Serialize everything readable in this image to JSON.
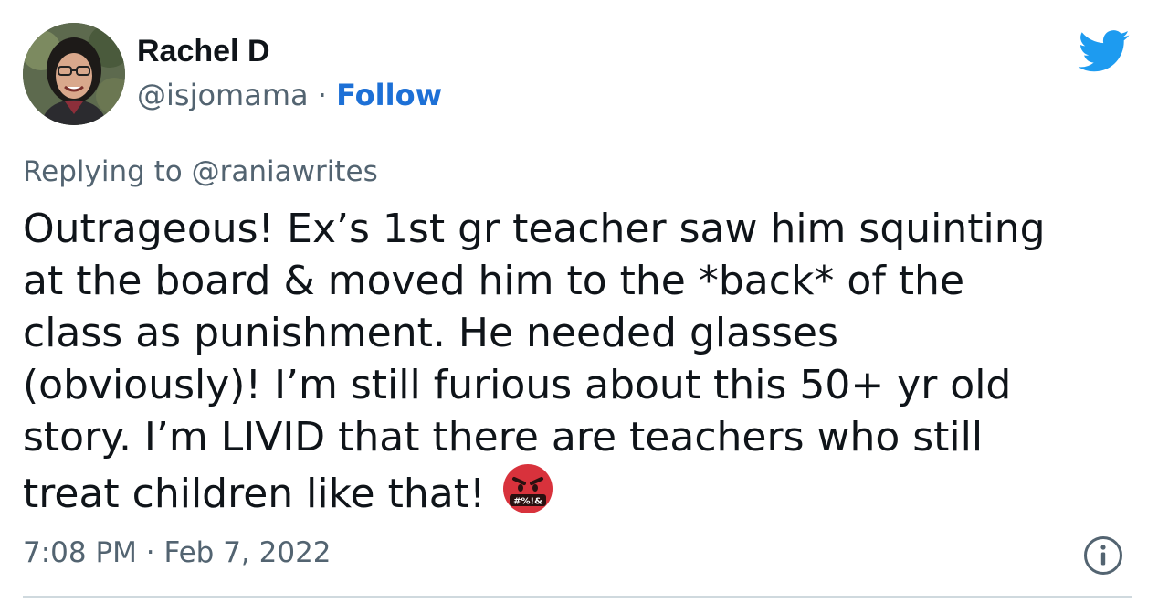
{
  "author": {
    "name": "Rachel D",
    "handle": "@isjomama",
    "separator": "·",
    "follow_label": "Follow"
  },
  "reply": {
    "prefix": "Replying to",
    "mention": "@raniawrites"
  },
  "tweet_text_lines": [
    "Outrageous! Ex’s 1st gr teacher saw him squinting",
    "at the board & moved him to the *back* of the",
    "class as punishment. He needed glasses",
    "(obviously)! I’m still furious about this 50+ yr old",
    "story. I’m LIVID that there are teachers who still",
    "treat children like that!"
  ],
  "emoji": {
    "icon": "face-with-symbols-on-mouth-icon",
    "symbols": "#%!&"
  },
  "timestamp": "7:08 PM · Feb 7, 2022",
  "icons": {
    "brand": "twitter-bird-icon",
    "info": "info-icon"
  },
  "colors": {
    "follow": "#1d70d6",
    "twitter_blue": "#1d9bf0",
    "secondary_text": "#536471",
    "primary_text": "#0f1419",
    "emoji_red": "#d8323c",
    "divider": "#cfd9de"
  }
}
